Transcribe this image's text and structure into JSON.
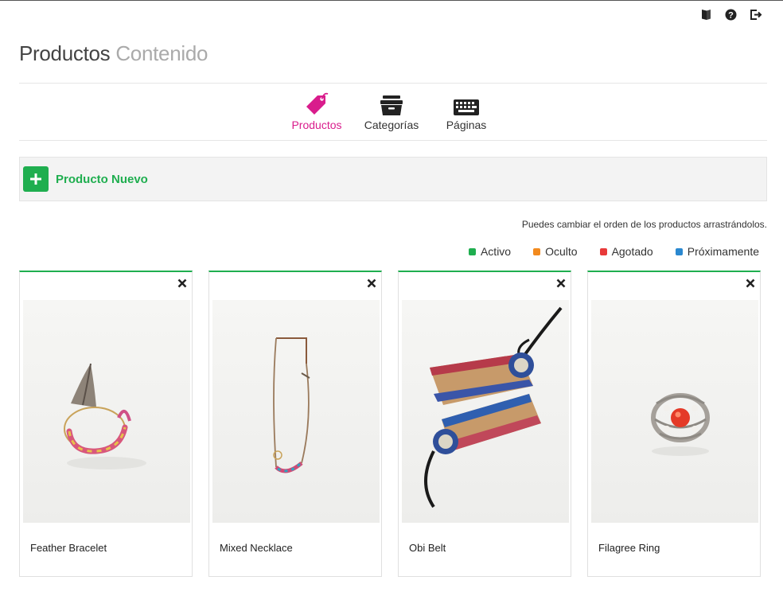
{
  "header": {
    "title": "Productos",
    "subtitle": "Contenido",
    "icons": [
      "book-icon",
      "help-icon",
      "logout-icon"
    ]
  },
  "tabs": [
    {
      "label": "Productos",
      "icon": "tag-icon",
      "active": true
    },
    {
      "label": "Categorías",
      "icon": "archive-box-icon",
      "active": false
    },
    {
      "label": "Páginas",
      "icon": "keyboard-icon",
      "active": false
    }
  ],
  "actions": {
    "new_product_label": "Producto Nuevo"
  },
  "hint": "Puedes cambiar el orden de los productos arrastrándolos.",
  "legend": [
    {
      "label": "Activo",
      "color": "#1fae4f"
    },
    {
      "label": "Oculto",
      "color": "#f28a1e"
    },
    {
      "label": "Agotado",
      "color": "#e83a3a"
    },
    {
      "label": "Próximamente",
      "color": "#2a88d0"
    }
  ],
  "colors": {
    "accent_active_tab": "#d91c8c",
    "green": "#1fae4f"
  },
  "products": [
    {
      "name": "Feather Bracelet",
      "status": "Activo"
    },
    {
      "name": "Mixed Necklace",
      "status": "Activo"
    },
    {
      "name": "Obi Belt",
      "status": "Activo"
    },
    {
      "name": "Filagree Ring",
      "status": "Activo"
    }
  ]
}
